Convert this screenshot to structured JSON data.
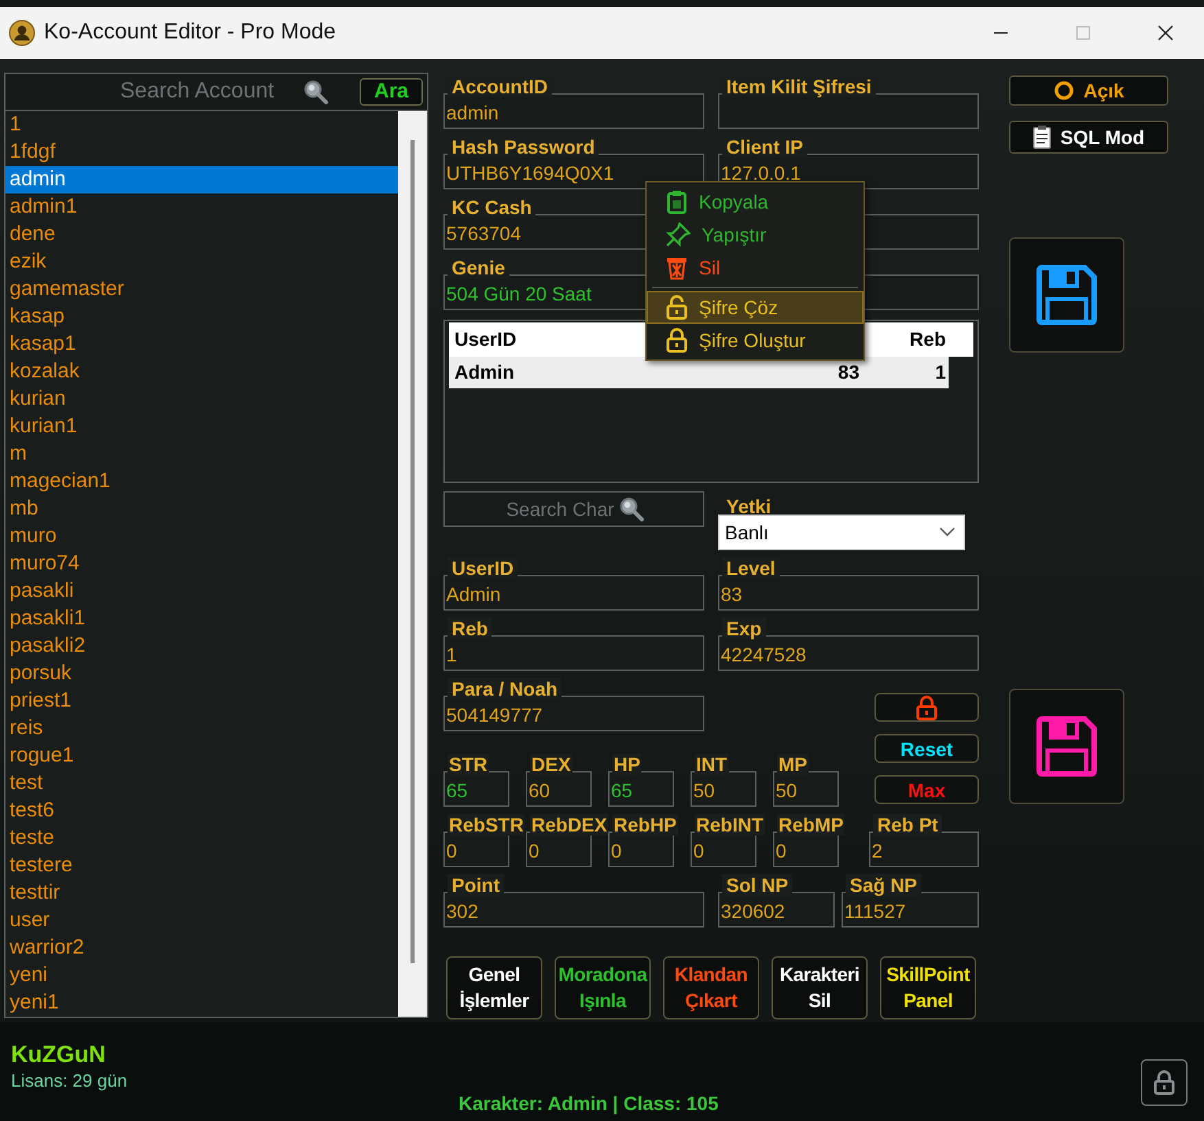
{
  "window": {
    "title": "Ko-Account Editor - Pro Mode"
  },
  "account_panel": {
    "search": {
      "placeholder": "Search Account"
    },
    "search_button": "Ara",
    "accounts": [
      {
        "name": "1",
        "selected": false
      },
      {
        "name": "1fdgf",
        "selected": false
      },
      {
        "name": "admin",
        "selected": true
      },
      {
        "name": "admin1",
        "selected": false
      },
      {
        "name": "dene",
        "selected": false
      },
      {
        "name": "ezik",
        "selected": false
      },
      {
        "name": "gamemaster",
        "selected": false
      },
      {
        "name": "kasap",
        "selected": false
      },
      {
        "name": "kasap1",
        "selected": false
      },
      {
        "name": "kozalak",
        "selected": false
      },
      {
        "name": "kurian",
        "selected": false
      },
      {
        "name": "kurian1",
        "selected": false
      },
      {
        "name": "m",
        "selected": false
      },
      {
        "name": "magecian1",
        "selected": false
      },
      {
        "name": "mb",
        "selected": false
      },
      {
        "name": "muro",
        "selected": false
      },
      {
        "name": "muro74",
        "selected": false
      },
      {
        "name": "pasakli",
        "selected": false
      },
      {
        "name": "pasakli1",
        "selected": false
      },
      {
        "name": "pasakli2",
        "selected": false
      },
      {
        "name": "porsuk",
        "selected": false
      },
      {
        "name": "priest1",
        "selected": false
      },
      {
        "name": "reis",
        "selected": false
      },
      {
        "name": "rogue1",
        "selected": false
      },
      {
        "name": "test",
        "selected": false
      },
      {
        "name": "test6",
        "selected": false
      },
      {
        "name": "teste",
        "selected": false
      },
      {
        "name": "testere",
        "selected": false
      },
      {
        "name": "testtir",
        "selected": false
      },
      {
        "name": "user",
        "selected": false
      },
      {
        "name": "warrior2",
        "selected": false
      },
      {
        "name": "yeni",
        "selected": false
      },
      {
        "name": "yeni1",
        "selected": false
      }
    ]
  },
  "user": {
    "name": "KuZGuN",
    "license": "Lisans: 29 gün"
  },
  "account_rows": [
    [
      {
        "label": "AccountID",
        "value": "admin",
        "color": "#e0a41c"
      },
      {
        "label": "Item Kilit Şifresi"
      }
    ],
    [
      {
        "label": "Hash Password",
        "value": "UTHB6Y1694Q0X1",
        "color": "#e0a41c"
      },
      {
        "label": "Client IP",
        "value": "127.0.0.1",
        "color": "#e0a41c"
      }
    ],
    [
      {
        "label": "KC Cash",
        "value": "5763704",
        "color": "#e0a41c"
      }
    ],
    [
      {
        "label": "Genie",
        "value": "504 Gün 20 Saat",
        "color": "#2fc02f"
      }
    ]
  ],
  "table": {
    "columns": [
      {
        "label": "UserID"
      },
      {},
      {
        "label": "Reb"
      }
    ],
    "rows": [
      {
        "cells": [
          "Admin",
          "83",
          "1"
        ],
        "selected": true
      }
    ]
  },
  "context_menu": [
    {
      "label": "Kopyala",
      "kind": "copy",
      "color": "#2fb52f",
      "selected": false
    },
    {
      "label": "Yapıştır",
      "kind": "paste",
      "color": "#2fb52f",
      "selected": false
    },
    {
      "label": "Sil",
      "kind": "delete",
      "color": "#ff4a10",
      "selected": false
    },
    {
      "label": "Şifre Çöz",
      "kind": "decrypt",
      "color": "#e8c020",
      "selected": true,
      "separator_before": true
    },
    {
      "label": "Şifre Oluştur",
      "kind": "encrypt",
      "color": "#e8c020",
      "selected": false
    }
  ],
  "char_search": {
    "placeholder": "Search Char"
  },
  "yetki": {
    "label": "Yetki",
    "value": "Banlı"
  },
  "char_fields": [
    {
      "label": "UserID",
      "value": "Admin",
      "color": "#e0a41c"
    },
    {
      "label": "Level",
      "value": "83",
      "color": "#e0a41c"
    },
    {
      "label": "Reb",
      "value": "1",
      "color": "#e0a41c"
    },
    {
      "label": "Exp",
      "value": "42247528",
      "color": "#e0a41c"
    },
    {
      "label": "Para / Noah",
      "value": "504149777",
      "color": "#e0a41c"
    }
  ],
  "stats": [
    {
      "label": "STR",
      "value": "65",
      "color": "#2fc02f"
    },
    {
      "label": "DEX",
      "value": "60",
      "color": "#e0a41c"
    },
    {
      "label": "HP",
      "value": "65",
      "color": "#2fc02f"
    },
    {
      "label": "INT",
      "value": "50",
      "color": "#e0a41c"
    },
    {
      "label": "MP",
      "value": "50",
      "color": "#e0a41c"
    }
  ],
  "reb_stats": [
    {
      "label": "RebSTR",
      "value": "0",
      "color": "#e0a41c"
    },
    {
      "label": "RebDEX",
      "value": "0",
      "color": "#e0a41c"
    },
    {
      "label": "RebHP",
      "value": "0",
      "color": "#e0a41c"
    },
    {
      "label": "RebINT",
      "value": "0",
      "color": "#e0a41c"
    },
    {
      "label": "RebMP",
      "value": "0",
      "color": "#e0a41c"
    },
    {
      "label": "Reb Pt",
      "value": "2",
      "color": "#e0a41c"
    }
  ],
  "points": [
    {
      "label": "Point",
      "value": "302",
      "color": "#e0a41c"
    },
    {
      "label": "Sol NP",
      "value": "320602",
      "color": "#e0a41c"
    },
    {
      "label": "Sağ NP",
      "value": "111527",
      "color": "#e0a41c"
    }
  ],
  "side_buttons": [
    {
      "kind": "lock",
      "color": "#ff3a00"
    },
    {
      "kind": "text",
      "label": "Reset",
      "color": "#00e5ff"
    },
    {
      "kind": "text",
      "label": "Max",
      "color": "#ff1010"
    }
  ],
  "action_buttons": [
    {
      "label": "Genel İşlemler",
      "color": "#ffffff"
    },
    {
      "label": "Moradona Işınla",
      "color": "#2fc02f"
    },
    {
      "label": "Klandan Çıkart",
      "color": "#ff4a10"
    },
    {
      "label": "Karakteri Sil",
      "color": "#ffffff"
    },
    {
      "label": "SkillPoint Panel",
      "color": "#f0e000"
    }
  ],
  "top_buttons": [
    {
      "label": "Açık",
      "kind": "ring",
      "color": "#f0a000"
    },
    {
      "label": "SQL Mod",
      "kind": "clipboard",
      "color": "#ffffff"
    }
  ],
  "save_buttons": [
    {
      "color": "#1a9bff"
    },
    {
      "color": "#ff1aa8"
    }
  ],
  "status": "Karakter: Admin | Class: 105"
}
